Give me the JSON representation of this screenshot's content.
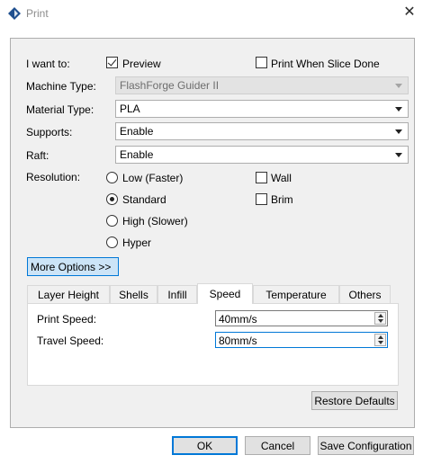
{
  "window": {
    "title": "Print"
  },
  "form": {
    "i_want_to_label": "I want to:",
    "preview_label": "Preview",
    "print_when_slice_done_label": "Print When Slice Done",
    "machine_type_label": "Machine Type:",
    "machine_type_value": "FlashForge Guider II",
    "material_type_label": "Material Type:",
    "material_type_value": "PLA",
    "supports_label": "Supports:",
    "supports_value": "Enable",
    "raft_label": "Raft:",
    "raft_value": "Enable",
    "resolution_label": "Resolution:",
    "resolution_options": [
      "Low (Faster)",
      "Standard",
      "High (Slower)",
      "Hyper"
    ],
    "resolution_selected": "Standard",
    "wall_label": "Wall",
    "brim_label": "Brim",
    "more_options_label": "More Options >>"
  },
  "tabs": [
    {
      "label": "Layer Height"
    },
    {
      "label": "Shells"
    },
    {
      "label": "Infill"
    },
    {
      "label": "Speed"
    },
    {
      "label": "Temperature"
    },
    {
      "label": "Others"
    }
  ],
  "active_tab": "Speed",
  "speed_tab": {
    "print_speed_label": "Print Speed:",
    "print_speed_value": "40mm/s",
    "travel_speed_label": "Travel Speed:",
    "travel_speed_value": "80mm/s"
  },
  "buttons": {
    "restore_defaults": "Restore Defaults",
    "ok": "OK",
    "cancel": "Cancel",
    "save_configuration": "Save Configuration"
  },
  "colors": {
    "accent": "#0078d7",
    "selected_button_bg": "#cce4f7"
  },
  "icons": {
    "app": "diamond-logo-icon",
    "close": "close-icon"
  }
}
